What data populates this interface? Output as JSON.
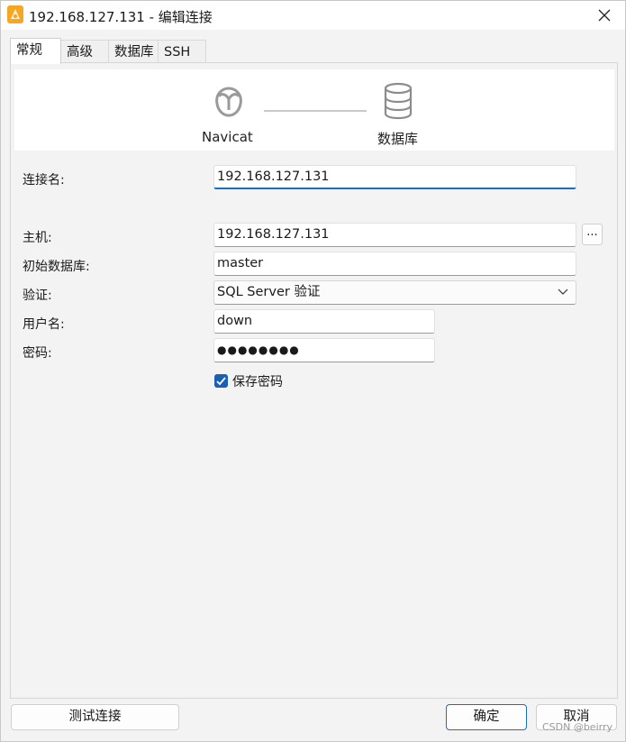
{
  "window": {
    "title": "192.168.127.131 - 编辑连接",
    "close_icon": "close-icon",
    "app_icon": "navicat-app-icon"
  },
  "tabs": [
    {
      "label": "常规",
      "active": true
    },
    {
      "label": "高级",
      "active": false
    },
    {
      "label": "数据库",
      "active": false
    },
    {
      "label": "SSH",
      "active": false
    }
  ],
  "header": {
    "left_label": "Navicat",
    "right_label": "数据库",
    "left_icon": "navicat-logo-icon",
    "right_icon": "database-icon"
  },
  "form": {
    "connection_name": {
      "label": "连接名:",
      "value": "192.168.127.131"
    },
    "host": {
      "label": "主机:",
      "value": "192.168.127.131",
      "browse_label": "..."
    },
    "initial_db": {
      "label": "初始数据库:",
      "value": "master"
    },
    "auth": {
      "label": "验证:",
      "value": "SQL Server 验证"
    },
    "username": {
      "label": "用户名:",
      "value": "down"
    },
    "password": {
      "label": "密码:",
      "value": "●●●●●●●●"
    },
    "save_password": {
      "label": "保存密码",
      "checked": true
    }
  },
  "buttons": {
    "test": "测试连接",
    "ok": "确定",
    "cancel": "取消"
  },
  "watermark": "CSDN @beirry",
  "colors": {
    "accent": "#1a6fc4",
    "checkbox": "#1a5fb4",
    "app_icon": "#f5a623"
  }
}
